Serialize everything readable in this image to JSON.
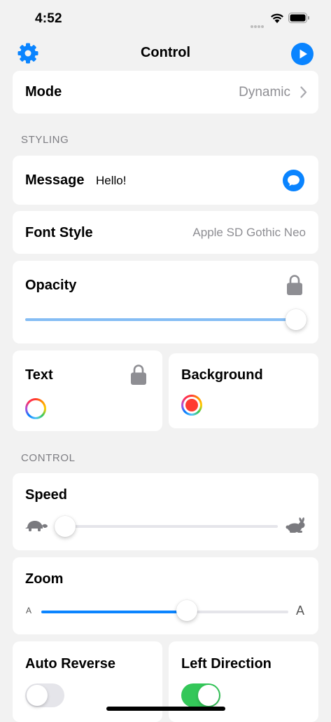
{
  "status_bar": {
    "time": "4:52"
  },
  "nav": {
    "title": "Control",
    "settings_icon": "gear-icon",
    "play_icon": "play-icon"
  },
  "mode": {
    "label": "Mode",
    "value": "Dynamic"
  },
  "sections": {
    "styling": "STYLING",
    "control": "CONTROL"
  },
  "message": {
    "label": "Message",
    "value": "Hello!"
  },
  "font_style": {
    "label": "Font Style",
    "value": "Apple SD Gothic Neo"
  },
  "opacity": {
    "label": "Opacity",
    "value": 1.0
  },
  "text_color": {
    "label": "Text"
  },
  "background_color": {
    "label": "Background",
    "color": "#ff3b30"
  },
  "speed": {
    "label": "Speed",
    "value": 0.0
  },
  "zoom": {
    "label": "Zoom",
    "min_label": "A",
    "max_label": "A",
    "value": 0.59
  },
  "auto_reverse": {
    "label": "Auto Reverse",
    "on": false
  },
  "left_direction": {
    "label": "Left Direction",
    "on": true
  },
  "colors": {
    "accent": "#0a84ff",
    "toggle_on": "#34c759",
    "background": "#f2f2f2"
  }
}
